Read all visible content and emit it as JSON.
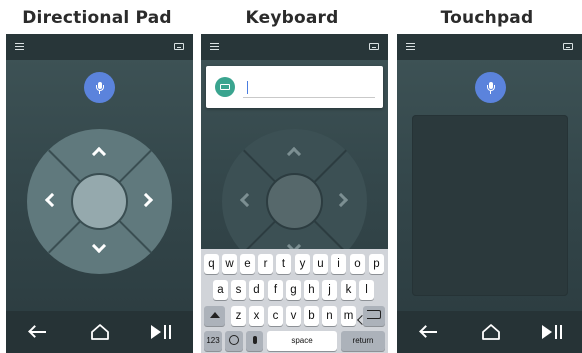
{
  "headings": {
    "directional_pad": "Directional Pad",
    "keyboard": "Keyboard",
    "touchpad": "Touchpad"
  },
  "icons": {
    "menu": "menu-icon",
    "keyboard_toggle": "keyboard-icon",
    "mic": "mic-icon",
    "back": "back-arrow-icon",
    "home": "home-icon",
    "play_pause": "play-pause-icon"
  },
  "colors": {
    "topbar": "#283639",
    "screen_bg": "#3f5457",
    "mic_button": "#5b83dc",
    "dpad_ring": "#60797d",
    "dpad_center": "#95a9ad",
    "keyboard_bg": "#d1d4d9",
    "keyboard_badge": "#3aa48f"
  },
  "keyboard_panel": {
    "input_value": "",
    "row1": [
      "q",
      "w",
      "e",
      "r",
      "t",
      "y",
      "u",
      "i",
      "o",
      "p"
    ],
    "row2": [
      "a",
      "s",
      "d",
      "f",
      "g",
      "h",
      "j",
      "k",
      "l"
    ],
    "row3": [
      "z",
      "x",
      "c",
      "v",
      "b",
      "n",
      "m"
    ],
    "numbers_key": "123",
    "space_key": "space",
    "return_key": "return"
  }
}
